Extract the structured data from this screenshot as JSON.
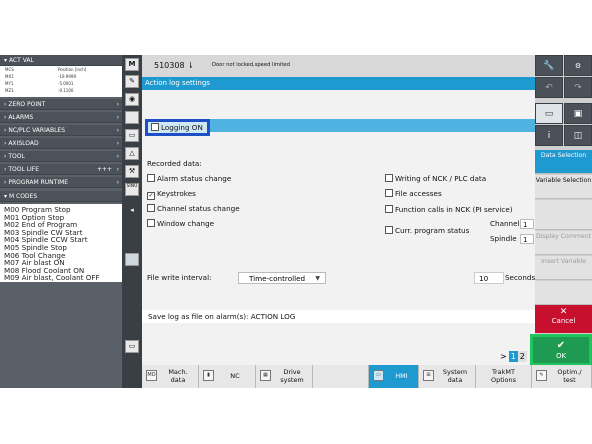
{
  "left_panel": {
    "actval_header": "ACT VAL",
    "actval_table": {
      "headers": [
        "MCS",
        "Position [inch]"
      ],
      "rows": [
        {
          "axis": "MX1",
          "value": "-19.9999"
        },
        {
          "axis": "MY1",
          "value": "-5.0001"
        },
        {
          "axis": "MZ1",
          "value": "-0.1100"
        }
      ]
    },
    "menu_items": [
      "ZERO POINT",
      "ALARMS",
      "NC/PLC VARIABLES",
      "AXISLOAD",
      "TOOL",
      "TOOL LIFE",
      "PROGRAM RUNTIME",
      "M CODES"
    ],
    "tool_life_suffix": "+++",
    "m_codes": [
      "M00 Program Stop",
      "M01 Option Stop",
      "M02 End of Program",
      "M03 Spindle CW Start",
      "M04 Spindle CCW Start",
      "M05 Spindle Stop",
      "M06 Tool Change",
      "M07 Air blast ON",
      "M08 Flood Coolant ON",
      "M09 Air blast, Coolant OFF"
    ]
  },
  "vstrip": {
    "items": [
      "M",
      "edit-icon",
      "jog-icon",
      "blank-icon",
      "window-icon",
      "triangle-icon",
      "wrench-icon",
      "SINU"
    ]
  },
  "header": {
    "program_number": "510308",
    "program_suffix": "⇂",
    "status_text": "Door not locked,speed limited"
  },
  "main": {
    "title": "Action log settings",
    "logging_label": "Logging ON",
    "recorded_data_label": "Recorded data:",
    "checkboxes_left": [
      {
        "label": "Alarm status change",
        "checked": false
      },
      {
        "label": "Keystrokes",
        "checked": true
      },
      {
        "label": "Channel status change",
        "checked": false
      },
      {
        "label": "Window change",
        "checked": false
      }
    ],
    "checkboxes_right": [
      {
        "label": "Writing of NCK / PLC data",
        "checked": false
      },
      {
        "label": "File accesses",
        "checked": false
      },
      {
        "label": "Function calls in NCK (PI service)",
        "checked": false
      },
      {
        "label": "Curr. program status",
        "checked": false
      }
    ],
    "channel_label": "Channel",
    "channel_value": "1",
    "spindle_label": "Spindle",
    "spindle_value": "1",
    "file_write_label": "File write interval:",
    "file_write_value": "Time-controlled",
    "interval_value": "10",
    "interval_unit": "Seconds",
    "save_log_label": "Save log as file on alarm(s): ACTION LOG",
    "pager": {
      "arrow": ">",
      "page1": "1",
      "page2": "2"
    }
  },
  "right_softkeys": {
    "data_selection": "Data Selection",
    "variable_selection": "Variable Selection",
    "display_comment": "Display Comment",
    "insert_variable": "Insert Variable",
    "cancel": "Cancel",
    "ok": "OK"
  },
  "bottom_softkeys": [
    {
      "label1": "Mach.",
      "label2": "data",
      "icon": "MD"
    },
    {
      "label1": "NC",
      "label2": "",
      "icon": "nc-icon"
    },
    {
      "label1": "Drive",
      "label2": "system",
      "icon": "drive-icon"
    },
    {
      "label1": "HMI",
      "label2": "",
      "icon": "hmi-icon",
      "selected": true
    },
    {
      "label1": "System",
      "label2": "data",
      "icon": "tree-icon"
    },
    {
      "label1": "TrakMT",
      "label2": "Options",
      "icon": ""
    },
    {
      "label1": "Optim./",
      "label2": "test",
      "icon": "optim-icon"
    }
  ],
  "colors": {
    "accent_blue": "#1f9ad1",
    "highlight_box": "#1f4fc7",
    "ok_green": "#1f9a52",
    "cancel_red": "#c8102e"
  }
}
